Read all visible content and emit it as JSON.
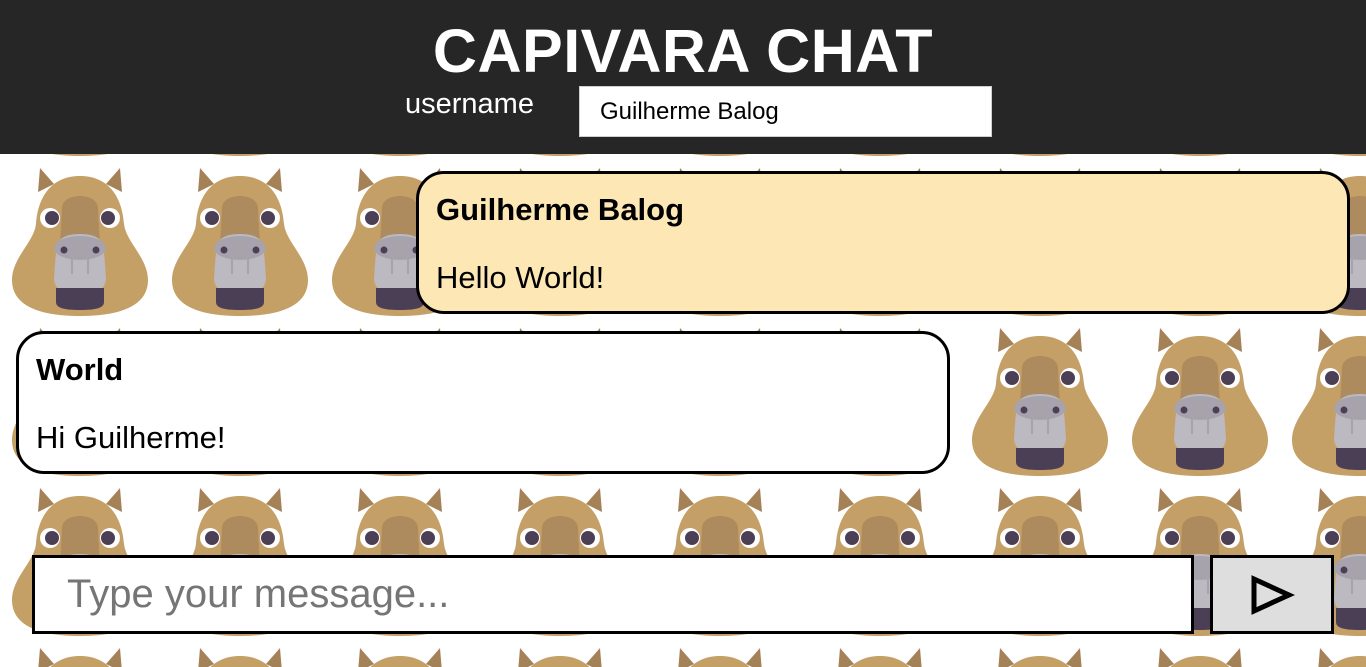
{
  "header": {
    "title": "CAPIVARA CHAT",
    "username_label": "username",
    "username_value": "Guilherme Balog"
  },
  "messages": [
    {
      "author": "Guilherme Balog",
      "text": "Hello World!",
      "own": true
    },
    {
      "author": "World",
      "text": "Hi Guilherme!",
      "own": false
    }
  ],
  "composer": {
    "placeholder": "Type your message...",
    "value": "",
    "send_icon": "play-triangle-icon"
  },
  "colors": {
    "header_bg": "#262626",
    "own_message_bg": "#fde8b5",
    "other_message_bg": "#ffffff",
    "send_button_bg": "#dedede",
    "capybara_fur": "#c4a067"
  }
}
